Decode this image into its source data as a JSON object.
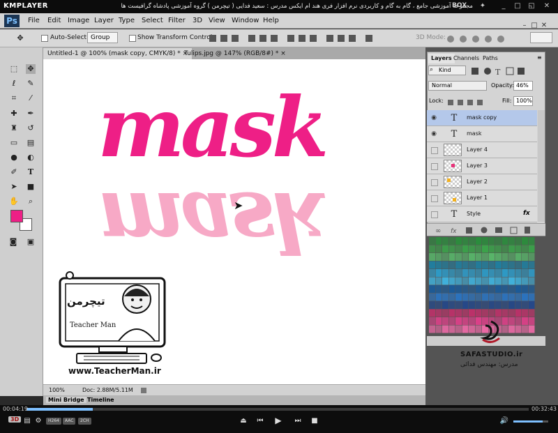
{
  "kmplayer": {
    "logo": "KMPLAYER",
    "caption": "مجموعه آموزشی جامع ، گام به گام و کاربردی نرم افزار فری هند ام ایکس   مدرس : سعید فدایی ( تیچرمن ) گروه آموزشی پادشاه گرافیست ها",
    "box_label": "BOX",
    "time_elapsed": "00:04:19",
    "time_total": "00:32:43",
    "codecs": [
      "H264",
      "AAC",
      "2CH"
    ],
    "badge": "3D"
  },
  "photoshop": {
    "logo": "Ps",
    "menu": [
      "File",
      "Edit",
      "Image",
      "Layer",
      "Type",
      "Select",
      "Filter",
      "3D",
      "View",
      "Window",
      "Help"
    ],
    "options": {
      "auto_select": "Auto-Select:",
      "group": "Group",
      "show_transform": "Show Transform Controls",
      "mode_3d": "3D Mode:"
    },
    "tabs": [
      {
        "label": "Untitled-1 @ 100% (mask copy, CMYK/8) *"
      },
      {
        "label": "Tulips.jpg @ 147% (RGB/8#) *"
      }
    ],
    "canvas_text": "mask",
    "status": {
      "zoom": "100%",
      "doc": "Doc: 2.88M/5.11M"
    },
    "bottom_tabs": [
      "Mini Bridge",
      "Timeline"
    ],
    "foreground_color": "#ee1f86",
    "background_color": "#ffffff"
  },
  "layers_panel": {
    "tabs": [
      "Layers",
      "Channels",
      "Paths"
    ],
    "kind": "Kind",
    "blend_mode": "Normal",
    "opacity_label": "Opacity:",
    "opacity": "46%",
    "lock_label": "Lock:",
    "fill_label": "Fill:",
    "fill": "100%",
    "layers": [
      {
        "name": "mask copy",
        "type": "text",
        "visible": true,
        "selected": true
      },
      {
        "name": "mask",
        "type": "text",
        "visible": true,
        "selected": false
      },
      {
        "name": "Layer 4",
        "type": "pixel",
        "visible": false,
        "selected": false
      },
      {
        "name": "Layer 3",
        "type": "pixel",
        "visible": false,
        "selected": false
      },
      {
        "name": "Layer 2",
        "type": "pixel",
        "visible": false,
        "selected": false
      },
      {
        "name": "Layer 1",
        "type": "pixel",
        "visible": false,
        "selected": false
      },
      {
        "name": "Style",
        "type": "text",
        "visible": false,
        "selected": false
      }
    ]
  },
  "watermark": {
    "brand": "تیچرمن",
    "brand_sub": "Teacher Man",
    "url": "www.TeacherMan.ir",
    "studio": "SAFASTUDIO.ir",
    "teacher": "مدرس: مهندس فدائی"
  }
}
